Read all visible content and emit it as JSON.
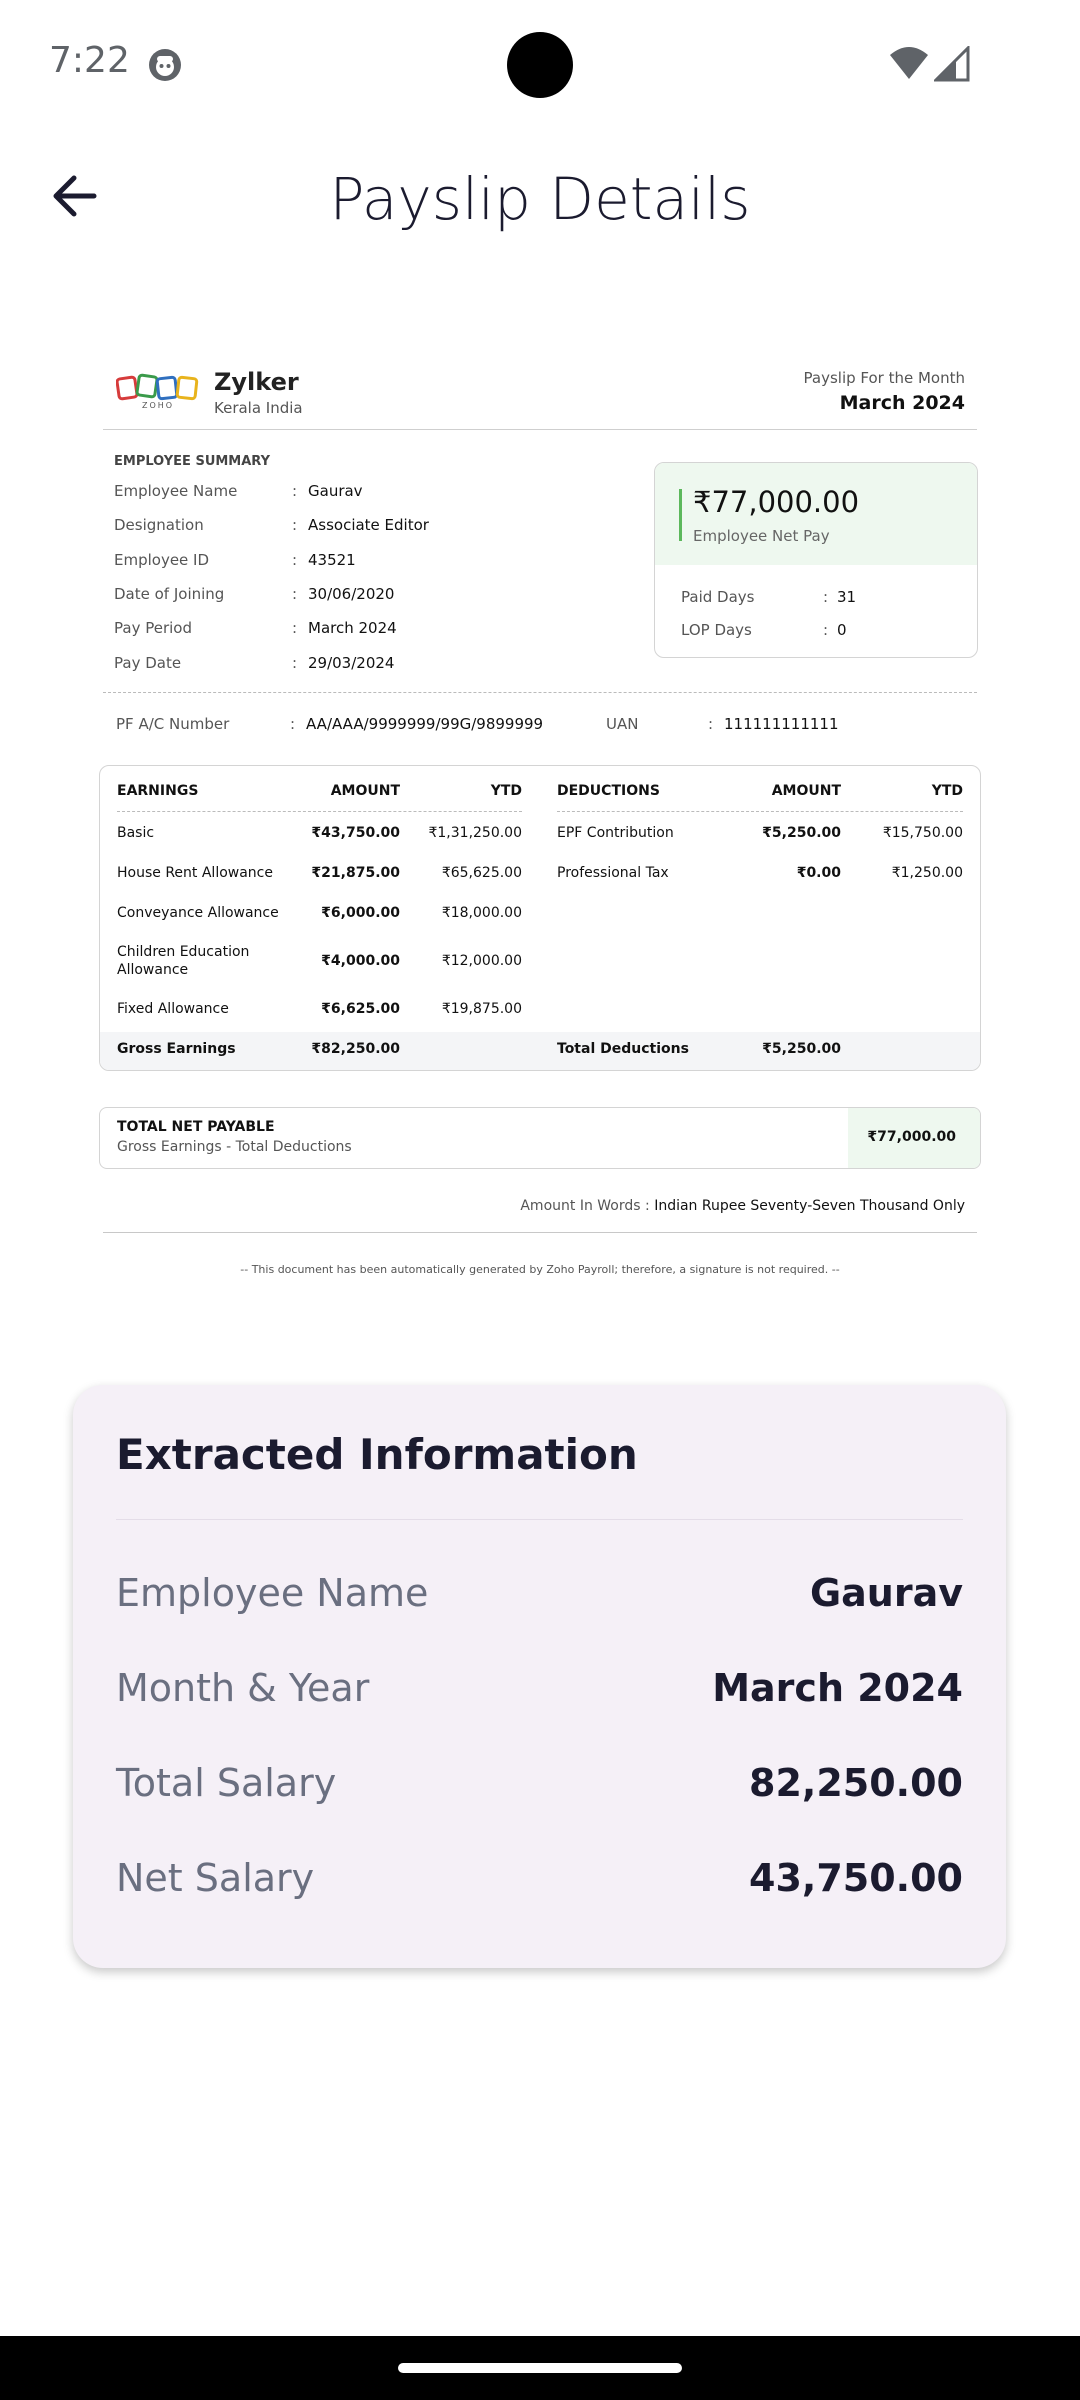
{
  "status_bar": {
    "time": "7:22"
  },
  "app_bar": {
    "title": "Payslip Details"
  },
  "payslip": {
    "company": {
      "name": "Zylker",
      "location": "Kerala India",
      "logo_text": "ZOHO"
    },
    "month_label": "Payslip For the Month",
    "month_value": "March 2024",
    "summary_heading": "EMPLOYEE SUMMARY",
    "summary": [
      {
        "label": "Employee Name",
        "value": "Gaurav"
      },
      {
        "label": "Designation",
        "value": "Associate Editor"
      },
      {
        "label": "Employee ID",
        "value": "43521"
      },
      {
        "label": "Date of Joining",
        "value": "30/06/2020"
      },
      {
        "label": "Pay Period",
        "value": "March 2024"
      },
      {
        "label": "Pay Date",
        "value": "29/03/2024"
      }
    ],
    "net_pay_box": {
      "amount": "₹77,000.00",
      "caption": "Employee Net Pay",
      "paid_days_label": "Paid Days",
      "paid_days": "31",
      "lop_days_label": "LOP Days",
      "lop_days": "0"
    },
    "pf_label": "PF A/C Number",
    "pf_value": "AA/AAA/9999999/99G/9899999",
    "uan_label": "UAN",
    "uan_value": "111111111111",
    "table": {
      "headers": {
        "earnings": "EARNINGS",
        "amount": "AMOUNT",
        "ytd": "YTD",
        "deductions": "DEDUCTIONS",
        "d_amount": "AMOUNT",
        "d_ytd": "YTD"
      },
      "earnings": [
        {
          "name": "Basic",
          "amount": "₹43,750.00",
          "ytd": "₹1,31,250.00"
        },
        {
          "name": "House Rent Allowance",
          "amount": "₹21,875.00",
          "ytd": "₹65,625.00"
        },
        {
          "name": "Conveyance Allowance",
          "amount": "₹6,000.00",
          "ytd": "₹18,000.00"
        },
        {
          "name": "Children Education",
          "name2": "Allowance",
          "amount": "₹4,000.00",
          "ytd": "₹12,000.00"
        },
        {
          "name": "Fixed Allowance",
          "amount": "₹6,625.00",
          "ytd": "₹19,875.00"
        }
      ],
      "deductions": [
        {
          "name": "EPF Contribution",
          "amount": "₹5,250.00",
          "ytd": "₹15,750.00"
        },
        {
          "name": "Professional Tax",
          "amount": "₹0.00",
          "ytd": "₹1,250.00"
        }
      ],
      "gross_label": "Gross Earnings",
      "gross_value": "₹82,250.00",
      "total_ded_label": "Total Deductions",
      "total_ded_value": "₹5,250.00"
    },
    "net_payable": {
      "title": "TOTAL NET PAYABLE",
      "subtitle": "Gross Earnings - Total Deductions",
      "value": "₹77,000.00"
    },
    "words_label": "Amount In Words :",
    "words_value": "Indian Rupee Seventy-Seven Thousand Only",
    "footer": "-- This document has been automatically generated by Zoho Payroll; therefore, a signature is not required. --"
  },
  "extracted": {
    "title": "Extracted Information",
    "rows": [
      {
        "label": "Employee Name",
        "value": "Gaurav"
      },
      {
        "label": "Month & Year",
        "value": "March 2024"
      },
      {
        "label": "Total Salary",
        "value": "82,250.00"
      },
      {
        "label": "Net Salary",
        "value": "43,750.00"
      }
    ]
  }
}
